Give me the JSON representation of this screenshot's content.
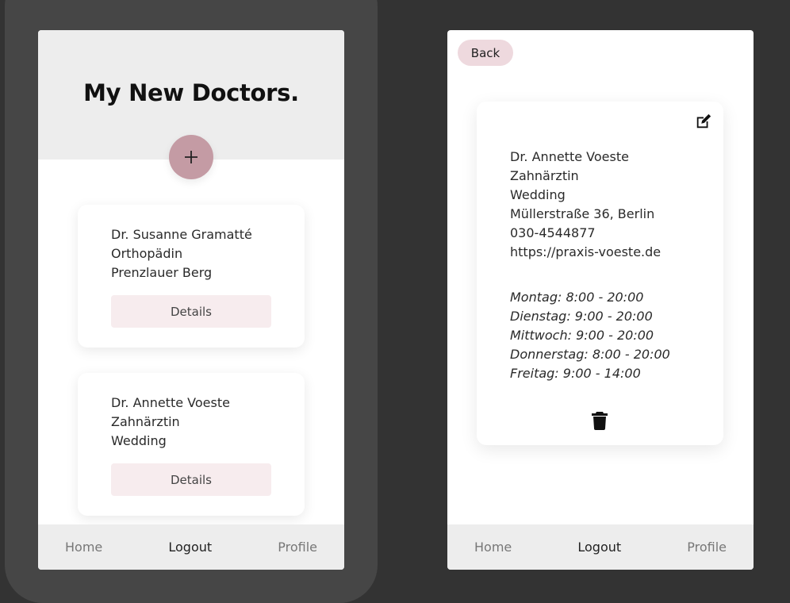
{
  "list_screen": {
    "title": "My New Doctors.",
    "add_button_icon": "plus-icon",
    "doctors": [
      {
        "name": "Dr. Susanne Gramatté",
        "specialty": "Orthopädin",
        "district": "Prenzlauer Berg",
        "details_label": "Details"
      },
      {
        "name": "Dr. Annette Voeste",
        "specialty": "Zahnärztin",
        "district": "Wedding",
        "details_label": "Details"
      }
    ],
    "nav": {
      "home": "Home",
      "logout": "Logout",
      "profile": "Profile"
    }
  },
  "detail_screen": {
    "back_label": "Back",
    "edit_icon": "edit-icon",
    "delete_icon": "trash-icon",
    "doctor": {
      "name": "Dr. Annette Voeste",
      "specialty": "Zahnärztin",
      "district": "Wedding",
      "address": "Müllerstraße 36, Berlin",
      "phone": "030-4544877",
      "website": "https://praxis-voeste.de"
    },
    "opening_hours": [
      "Montag: 8:00 - 20:00",
      "Dienstag: 9:00 - 20:00",
      "Mittwoch: 9:00 - 20:00",
      "Donnerstag: 8:00 - 20:00",
      "Freitag: 9:00 - 14:00"
    ],
    "nav": {
      "home": "Home",
      "logout": "Logout",
      "profile": "Profile"
    }
  },
  "colors": {
    "accent": "#c49ba4",
    "details_button_bg": "#f7ecee",
    "back_button_bg": "#eed9de",
    "header_bg": "#ededed",
    "page_bg": "#333333",
    "phone_frame": "#464646"
  }
}
